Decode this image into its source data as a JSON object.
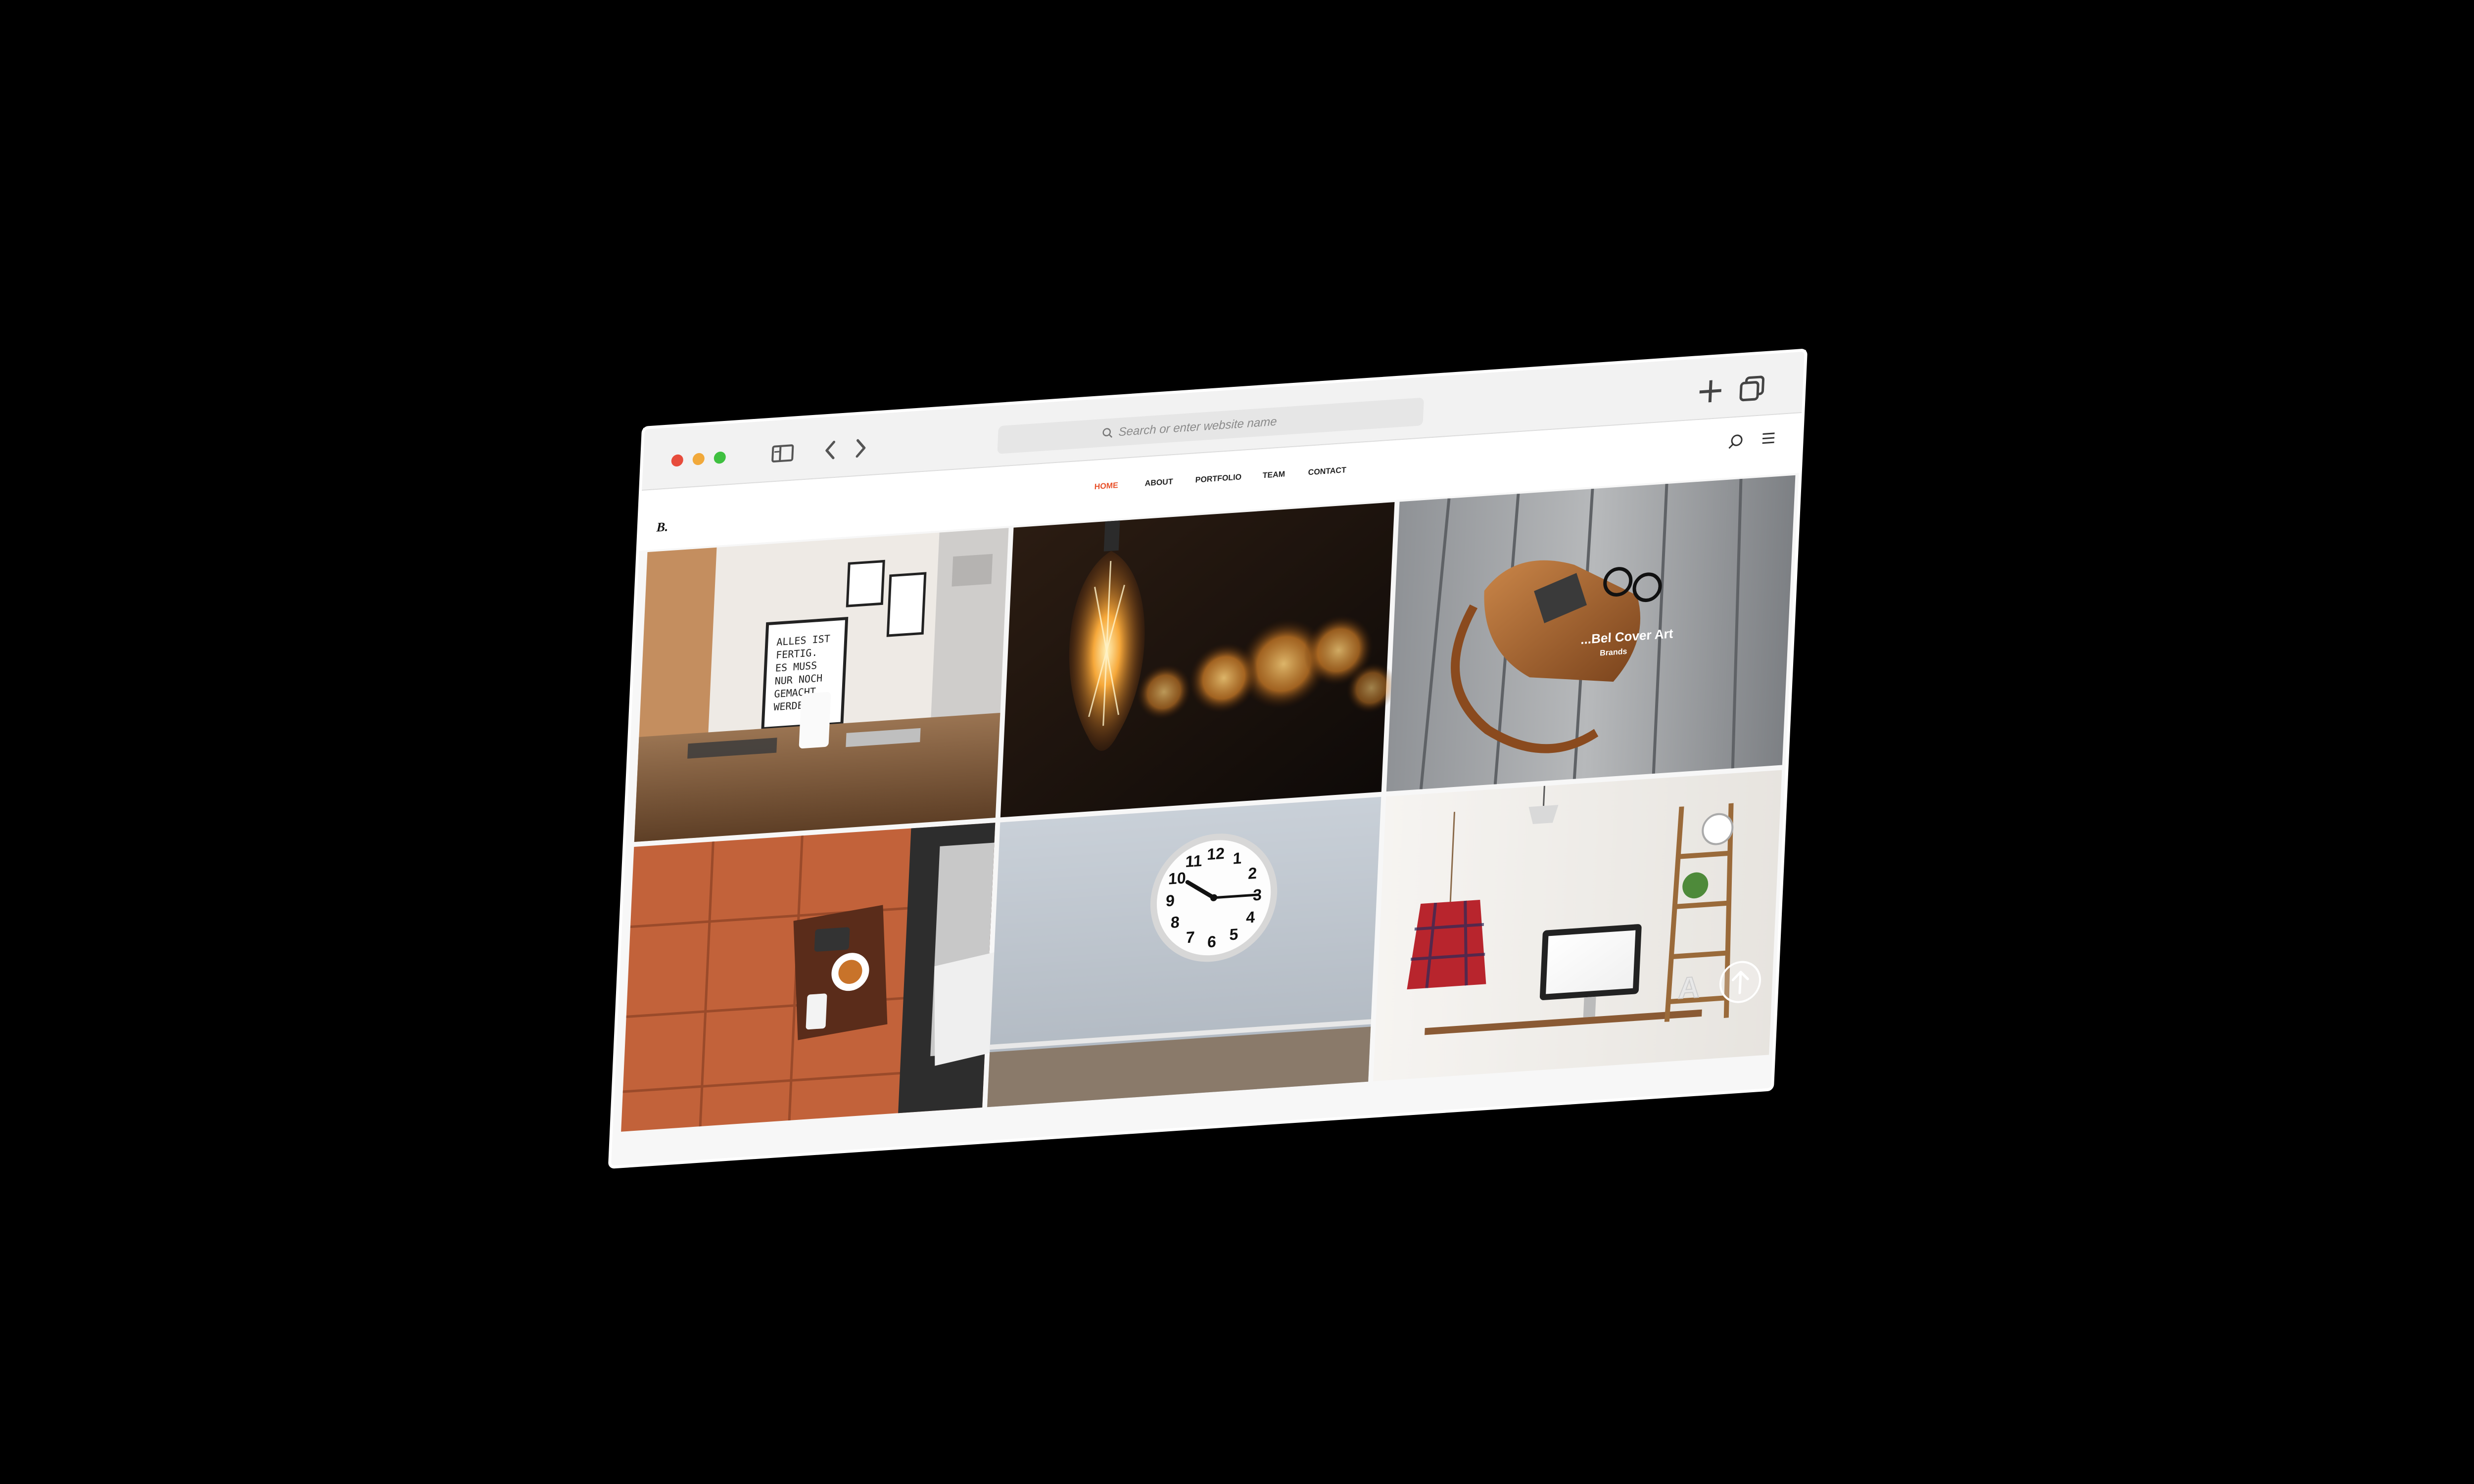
{
  "browser": {
    "window_controls": {
      "close_color": "#e74c3c",
      "minimize_color": "#f1a93b",
      "zoom_color": "#3fc040"
    },
    "toolbar": {
      "sidebar_icon": "sidebar-icon",
      "back_icon": "chevron-left-icon",
      "forward_icon": "chevron-right-icon",
      "new_tab_icon": "plus-icon",
      "tabs_icon": "tabs-overview-icon"
    },
    "address_bar": {
      "placeholder": "Search or enter website name",
      "icon": "search-icon"
    }
  },
  "site": {
    "logo": "B.",
    "nav": {
      "home": "HOME",
      "about": "ABOUT",
      "portfolio": "PORTFOLIO",
      "team": "TEAM",
      "contact": "CONTACT"
    },
    "active_nav": "HOME",
    "accent_color": "#e8512a",
    "header_icons": [
      "search-icon",
      "menu-icon"
    ]
  },
  "gallery": {
    "items": [
      {
        "subject": "office-desk-with-posters",
        "poster_text": [
          "ALLES IST",
          "FERTIG.",
          "ES MUSS",
          "NUR NOCH",
          "GEMACHT",
          "WERDEN."
        ]
      },
      {
        "subject": "edison-light-bulb"
      },
      {
        "subject": "leather-bag",
        "caption_title": "...Bel Cover Art",
        "caption_sub": "Brands"
      },
      {
        "subject": "coffee-table-with-camera"
      },
      {
        "subject": "wall-clock",
        "clock_numbers": [
          "12",
          "1",
          "2",
          "3",
          "4",
          "5",
          "6",
          "7",
          "8",
          "9",
          "10",
          "11"
        ]
      },
      {
        "subject": "workspace-with-shirt-and-monitor",
        "decor_letter": "A"
      }
    ]
  },
  "scroll_top_icon": "arrow-up-icon"
}
